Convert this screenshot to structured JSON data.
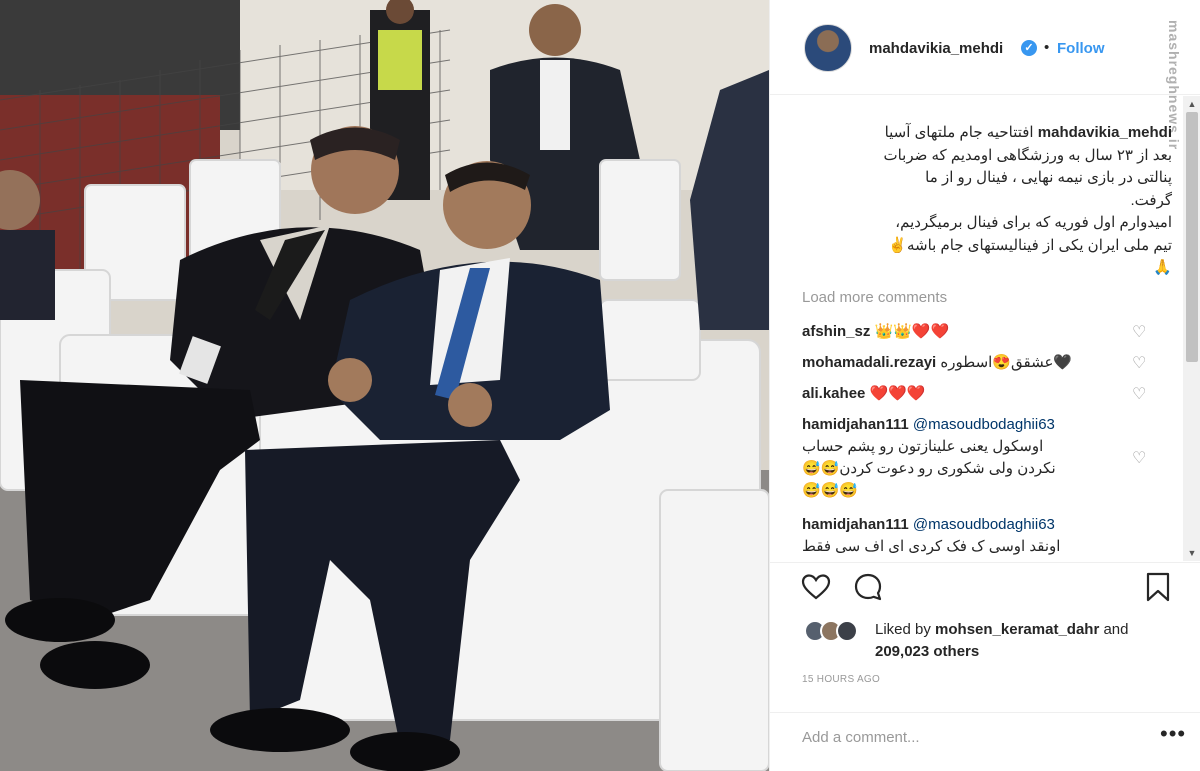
{
  "header": {
    "username": "mahdavikia_mehdi",
    "separator": "•",
    "follow_label": "Follow",
    "watermark": "mashreghnews.ir",
    "verified_icon": "verified-badge-icon"
  },
  "caption": {
    "username": "mahdavikia_mehdi",
    "lines": [
      "افتتاحیه جام ملتهای آسیا",
      "بعد از ۲۳ سال به ورزشگاهی اومدیم که ضربات",
      "پنالتی در بازی نیمه نهایی ، فینال رو از ما",
      "گرفت.",
      "امیدوارم اول فوریه که برای فینال برمیگردیم،",
      "تیم ملی ایران یکی از فینالیستهای جام باشه✌",
      "🙏"
    ]
  },
  "load_more": "Load more comments",
  "comments": [
    {
      "user": "afshin_sz",
      "text": "👑👑❤️❤️"
    },
    {
      "user": "mohamadali.rezayi",
      "text": "عشقق😍اسطوره🖤"
    },
    {
      "user": "ali.kahee",
      "text": "❤️❤️❤️"
    },
    {
      "user": "hamidjahan111",
      "mention": "@masoudbodaghii63",
      "lines": [
        "اوسکول یعنی علینازتون رو پشم حساب",
        "نکردن ولی شکوری رو دعوت کردن😅😅",
        "😅😅😅"
      ]
    },
    {
      "user": "hamidjahan111",
      "mention": "@masoudbodaghii63",
      "lines": [
        "اونقد اوسی ک فک کردی ای اف سی فقط"
      ]
    }
  ],
  "actions": {
    "like_icon": "heart-outline-icon",
    "comment_icon": "comment-bubble-icon",
    "save_icon": "bookmark-icon"
  },
  "likes": {
    "prefix": "Liked by ",
    "user": "mohsen_keramat_dahr",
    "and": " and",
    "count": "209,023 others"
  },
  "timestamp": "15 HOURS AGO",
  "add_comment": {
    "placeholder": "Add a comment...",
    "more": "•••"
  },
  "colors": {
    "accent": "#3897f0",
    "heart_red": "#ed4956",
    "muted": "#999999",
    "text": "#262626"
  }
}
